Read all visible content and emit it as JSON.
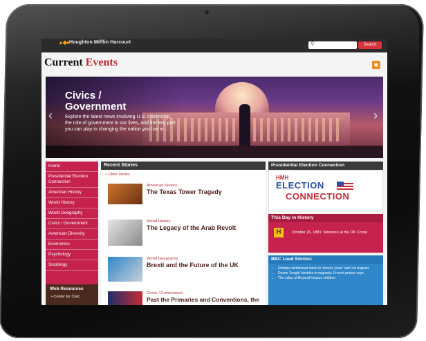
{
  "header": {
    "brand": "Houghton Mifflin Harcourt",
    "title_part1": "Current",
    "title_part2": "Events",
    "search_placeholder": "",
    "search_button": "Search"
  },
  "hero": {
    "title": "Civics / Government",
    "description": "Explore the latest news involving U.S. citizenship, the role of government in our lives, and the key part you can play in changing the nation you live in."
  },
  "leftnav": {
    "items": [
      "Home",
      "Presidential Election Connection",
      "American History",
      "World History",
      "World Geography",
      "Civics / Government",
      "American Diversity",
      "Economics",
      "Psychology",
      "Sociology"
    ],
    "web_resources_heading": "Web Resources",
    "web_resources_item": "Center for Civic"
  },
  "recent": {
    "heading": "Recent Stories",
    "older": "« Older stories",
    "stories": [
      {
        "category": "American History",
        "title": "The Texas Tower Tragedy"
      },
      {
        "category": "World History",
        "title": "The Legacy of the Arab Revolt"
      },
      {
        "category": "World Geography",
        "title": "Brexit and the Future of the UK"
      },
      {
        "category": "Civics / Government",
        "title": "Past the Primaries and Conventions, the"
      }
    ]
  },
  "right": {
    "election_heading": "Presidential Election Connection",
    "election_logo_line1": "HMH",
    "election_logo_line2": "ELECTION",
    "election_logo_line3": "CONNECTION",
    "tdih_heading": "This Day in History",
    "tdih_text": "October 26, 1881: Shootout at the OK Corral",
    "bbc_heading": "BBC Lead Stories:",
    "bbc_items": [
      "Ethiopia withdrawal move to 'shocks (over' 'wel' out migrant",
      "Dozen 'Jungle' besides to migrants, French protest says",
      "The value of Beyond Houses children"
    ]
  },
  "colors": {
    "accent": "#c62a34",
    "nav": "#c5234d",
    "bbc": "#2f86c9"
  },
  "icons": {
    "search": "search-icon",
    "rss": "rss-icon"
  }
}
